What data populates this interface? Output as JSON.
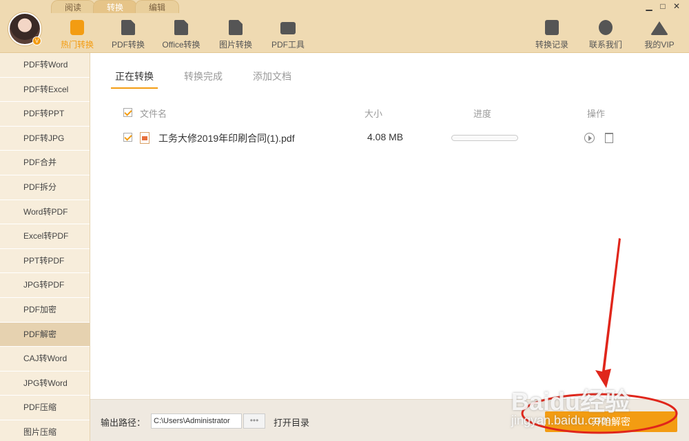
{
  "header": {
    "mode_tabs": [
      "阅读",
      "转换",
      "编辑"
    ],
    "nav": [
      "热门转换",
      "PDF转换",
      "Office转换",
      "图片转换",
      "PDF工具"
    ],
    "right_nav": [
      "转换记录",
      "联系我们",
      "我的VIP"
    ],
    "window_controls": [
      "▁",
      "□",
      "✕"
    ],
    "avatar_badge": "V"
  },
  "sidebar": {
    "items": [
      "PDF转Word",
      "PDF转Excel",
      "PDF转PPT",
      "PDF转JPG",
      "PDF合并",
      "PDF拆分",
      "Word转PDF",
      "Excel转PDF",
      "PPT转PDF",
      "JPG转PDF",
      "PDF加密",
      "PDF解密",
      "CAJ转Word",
      "JPG转Word",
      "PDF压缩",
      "图片压缩"
    ],
    "active": "PDF解密"
  },
  "main": {
    "tabs": [
      "正在转换",
      "转换完成",
      "添加文档"
    ],
    "columns": {
      "name": "文件名",
      "size": "大小",
      "progress": "进度",
      "actions": "操作"
    },
    "rows": [
      {
        "name": "工务大修2019年印刷合同(1).pdf",
        "size": "4.08 MB",
        "progress": 0
      }
    ]
  },
  "footer": {
    "output_label": "输出路径：",
    "path": "C:\\Users\\Administrator",
    "browse": "•••",
    "open_dir": "打开目录",
    "start": "开始解密"
  },
  "watermark": {
    "brand": "Baidu经验",
    "url": "jingyan.baidu.com"
  },
  "colors": {
    "accent": "#f39c12",
    "header_bg": "#efdab2",
    "sidebar_bg": "#f7eddb",
    "annotation": "#e0261b"
  }
}
